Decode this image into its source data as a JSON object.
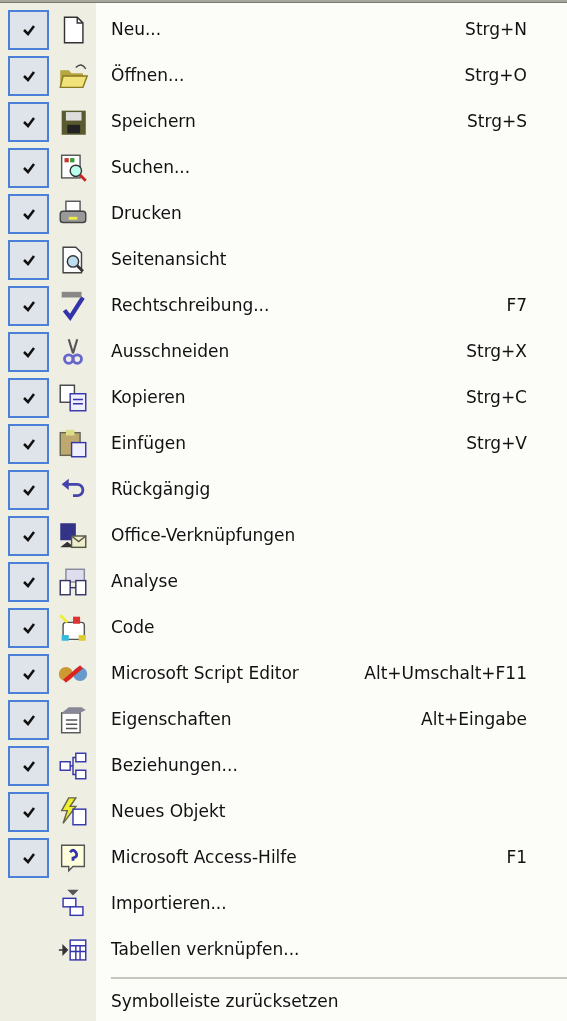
{
  "items": [
    {
      "label": "Neu...",
      "shortcut": "Strg+N",
      "checked": true
    },
    {
      "label": "Öffnen...",
      "shortcut": "Strg+O",
      "checked": true
    },
    {
      "label": "Speichern",
      "shortcut": "Strg+S",
      "checked": true
    },
    {
      "label": "Suchen...",
      "checked": true
    },
    {
      "label": "Drucken",
      "checked": true
    },
    {
      "label": "Seitenansicht",
      "checked": true
    },
    {
      "label": "Rechtschreibung...",
      "shortcut": "F7",
      "checked": true
    },
    {
      "label": "Ausschneiden",
      "shortcut": "Strg+X",
      "checked": true
    },
    {
      "label": "Kopieren",
      "shortcut": "Strg+C",
      "checked": true
    },
    {
      "label": "Einfügen",
      "shortcut": "Strg+V",
      "checked": true
    },
    {
      "label": "Rückgängig",
      "checked": true
    },
    {
      "label": "Office-Verknüpfungen",
      "checked": true
    },
    {
      "label": "Analyse",
      "checked": true
    },
    {
      "label": "Code",
      "checked": true
    },
    {
      "label": "Microsoft Script Editor",
      "shortcut": "Alt+Umschalt+F11",
      "checked": true
    },
    {
      "label": "Eigenschaften",
      "shortcut": "Alt+Eingabe",
      "checked": true
    },
    {
      "label": "Beziehungen...",
      "checked": true
    },
    {
      "label": "Neues Objekt",
      "checked": true
    },
    {
      "label": "Microsoft Access-Hilfe",
      "shortcut": "F1",
      "checked": true
    },
    {
      "label": "Importieren...",
      "checked": false
    },
    {
      "label": "Tabellen verknüpfen...",
      "checked": false
    }
  ],
  "reset_item": {
    "label": "Symbolleiste zurücksetzen"
  }
}
